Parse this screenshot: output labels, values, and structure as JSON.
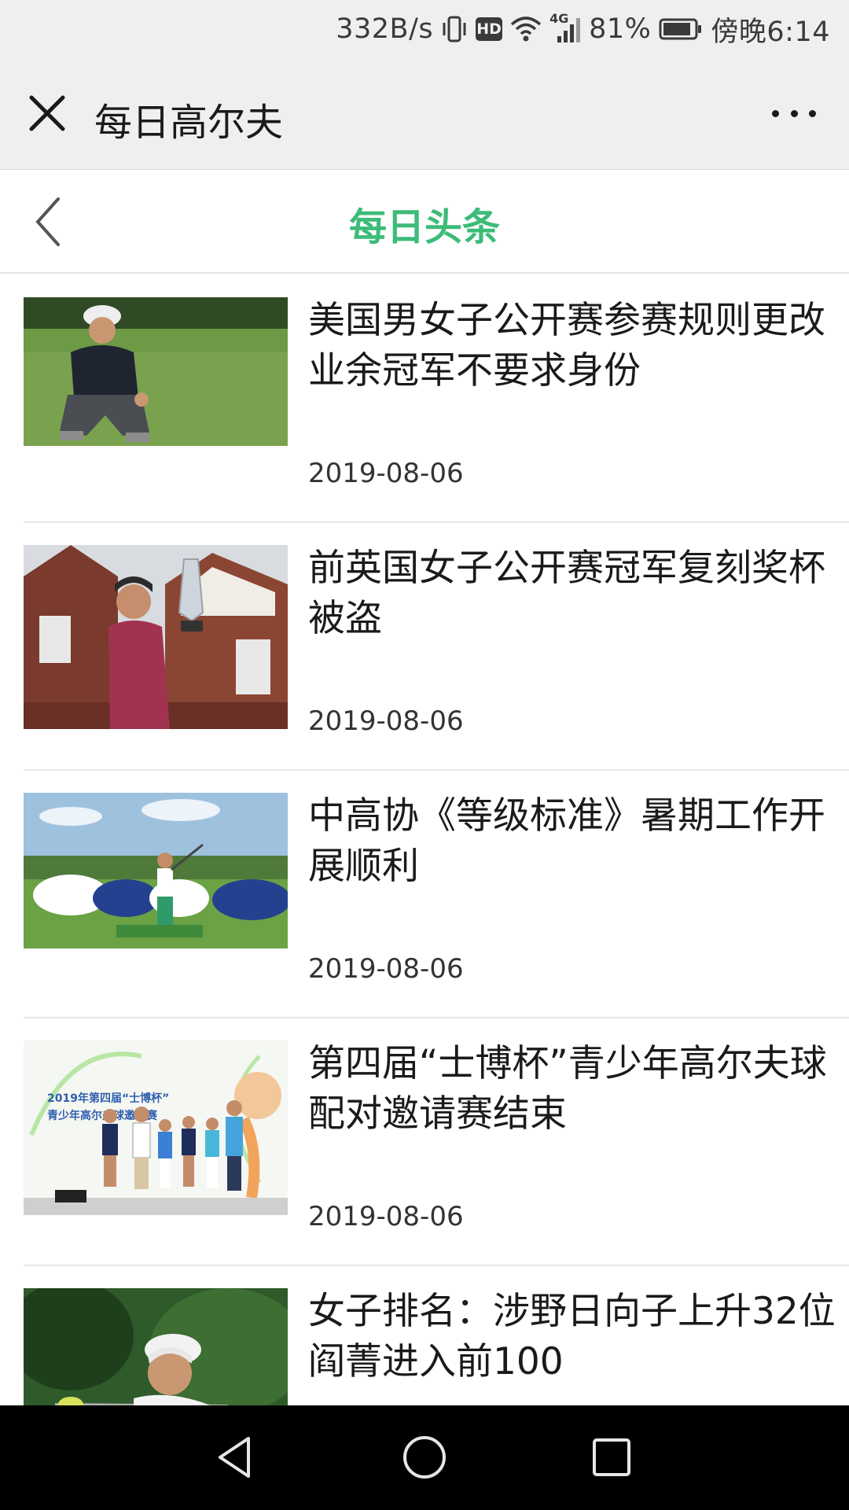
{
  "status_bar": {
    "network_speed": "332B/s",
    "hd_label": "HD",
    "network_type": "4G",
    "battery_percent": "81%",
    "time": "傍晚6:14",
    "icons": [
      "vibrate-icon",
      "hd-icon",
      "wifi-icon",
      "signal-icon",
      "battery-icon"
    ]
  },
  "header": {
    "title": "每日高尔夫",
    "close_icon": "close-icon",
    "more_icon": "more-icon"
  },
  "sub_header": {
    "title": "每日头条",
    "back_icon": "chevron-left-icon"
  },
  "news": [
    {
      "title": "美国男女子公开赛参赛规则更改业余冠军不要求身份",
      "date": "2019-08-06",
      "image": "golfer-crouching-photo"
    },
    {
      "title": "前英国女子公开赛冠军复刻奖杯被盗",
      "date": "2019-08-06",
      "image": "trophy-holder-photo"
    },
    {
      "title": "中高协《等级标准》暑期工作开展顺利",
      "date": "2019-08-06",
      "image": "junior-golf-swing-photo"
    },
    {
      "title": "第四届“士博杯”青少年高尔夫球配对邀请赛结束",
      "date": "2019-08-06",
      "image": "junior-award-ceremony-photo",
      "image_banner_lines": [
        "2019年第四届“士博杯”",
        "青少年高尔夫球邀请赛"
      ]
    },
    {
      "title": "女子排名：涉野日向子上升32位阎菁进入前100",
      "date": "",
      "image": "female-golfer-photo"
    }
  ],
  "nav_bar": {
    "back": "nav-back-icon",
    "home": "nav-home-icon",
    "recents": "nav-recents-icon"
  },
  "colors": {
    "accent_green": "#3dbb79",
    "header_bg": "#efefef",
    "nav_bg": "#000000"
  }
}
